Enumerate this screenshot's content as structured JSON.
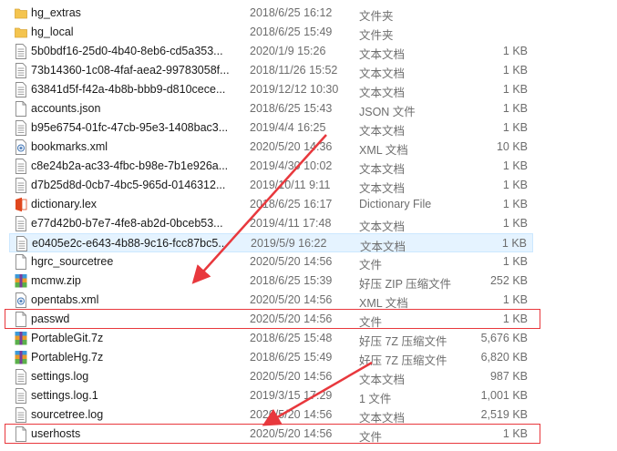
{
  "files": [
    {
      "name": "hg_extras",
      "date": "2018/6/25 16:12",
      "type": "文件夹",
      "size": "",
      "icon": "folder-icon"
    },
    {
      "name": "hg_local",
      "date": "2018/6/25 15:49",
      "type": "文件夹",
      "size": "",
      "icon": "folder-icon"
    },
    {
      "name": "5b0bdf16-25d0-4b40-8eb6-cd5a353...",
      "date": "2020/1/9 15:26",
      "type": "文本文档",
      "size": "1 KB",
      "icon": "text-file-icon"
    },
    {
      "name": "73b14360-1c08-4faf-aea2-99783058f...",
      "date": "2018/11/26 15:52",
      "type": "文本文档",
      "size": "1 KB",
      "icon": "text-file-icon"
    },
    {
      "name": "63841d5f-f42a-4b8b-bbb9-d810cece...",
      "date": "2019/12/12 10:30",
      "type": "文本文档",
      "size": "1 KB",
      "icon": "text-file-icon"
    },
    {
      "name": "accounts.json",
      "date": "2018/6/25 15:43",
      "type": "JSON 文件",
      "size": "1 KB",
      "icon": "blank-file-icon"
    },
    {
      "name": "b95e6754-01fc-47cb-95e3-1408bac3...",
      "date": "2019/4/4 16:25",
      "type": "文本文档",
      "size": "1 KB",
      "icon": "text-file-icon"
    },
    {
      "name": "bookmarks.xml",
      "date": "2020/5/20 14:36",
      "type": "XML 文档",
      "size": "10 KB",
      "icon": "xml-file-icon"
    },
    {
      "name": "c8e24b2a-ac33-4fbc-b98e-7b1e926a...",
      "date": "2019/4/30 10:02",
      "type": "文本文档",
      "size": "1 KB",
      "icon": "text-file-icon"
    },
    {
      "name": "d7b25d8d-0cb7-4bc5-965d-0146312...",
      "date": "2019/10/11 9:11",
      "type": "文本文档",
      "size": "1 KB",
      "icon": "text-file-icon"
    },
    {
      "name": "dictionary.lex",
      "date": "2018/6/25 16:17",
      "type": "Dictionary File",
      "size": "1 KB",
      "icon": "office-file-icon"
    },
    {
      "name": "e77d42b0-b7e7-4fe8-ab2d-0bceb53...",
      "date": "2019/4/11 17:48",
      "type": "文本文档",
      "size": "1 KB",
      "icon": "text-file-icon"
    },
    {
      "name": "e0405e2c-e643-4b88-9c16-fcc87bc5...",
      "date": "2019/5/9 16:22",
      "type": "文本文档",
      "size": "1 KB",
      "icon": "text-file-icon"
    },
    {
      "name": "hgrc_sourcetree",
      "date": "2020/5/20 14:56",
      "type": "文件",
      "size": "1 KB",
      "icon": "blank-file-icon"
    },
    {
      "name": "mcmw.zip",
      "date": "2018/6/25 15:39",
      "type": "好压 ZIP 压缩文件",
      "size": "252 KB",
      "icon": "archive-icon"
    },
    {
      "name": "opentabs.xml",
      "date": "2020/5/20 14:56",
      "type": "XML 文档",
      "size": "1 KB",
      "icon": "xml-file-icon"
    },
    {
      "name": "passwd",
      "date": "2020/5/20 14:56",
      "type": "文件",
      "size": "1 KB",
      "icon": "blank-file-icon"
    },
    {
      "name": "PortableGit.7z",
      "date": "2018/6/25 15:48",
      "type": "好压 7Z 压缩文件",
      "size": "5,676 KB",
      "icon": "archive-icon"
    },
    {
      "name": "PortableHg.7z",
      "date": "2018/6/25 15:49",
      "type": "好压 7Z 压缩文件",
      "size": "6,820 KB",
      "icon": "archive-icon"
    },
    {
      "name": "settings.log",
      "date": "2020/5/20 14:56",
      "type": "文本文档",
      "size": "987 KB",
      "icon": "text-file-icon"
    },
    {
      "name": "settings.log.1",
      "date": "2019/3/15 17:29",
      "type": "1 文件",
      "size": "1,001 KB",
      "icon": "text-file-icon"
    },
    {
      "name": "sourcetree.log",
      "date": "2020/5/20 14:56",
      "type": "文本文档",
      "size": "2,519 KB",
      "icon": "text-file-icon"
    },
    {
      "name": "userhosts",
      "date": "2020/5/20 14:56",
      "type": "文件",
      "size": "1 KB",
      "icon": "blank-file-icon"
    }
  ],
  "selected_index": 12,
  "highlighted_indices": [
    16,
    22
  ],
  "colors": {
    "selection": "#e5f3ff",
    "highlight_box": "#e8383d",
    "folder": "#f4c44e"
  }
}
